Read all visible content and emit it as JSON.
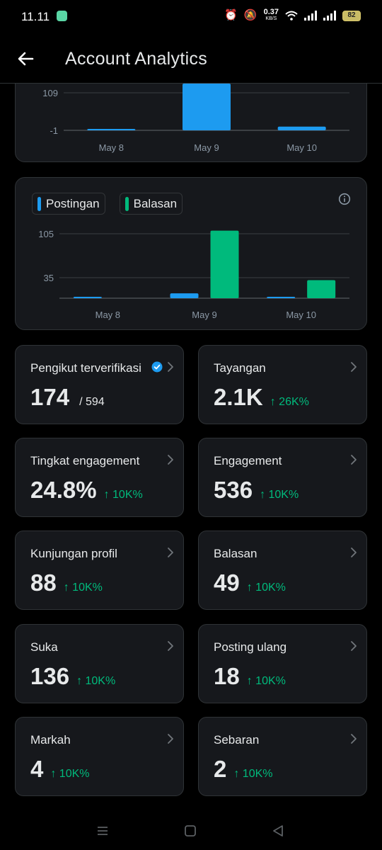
{
  "status_bar": {
    "time": "11.11",
    "network_speed": "0.37",
    "network_unit": "KB/S",
    "battery": "82",
    "icons": [
      "whatsapp-icon",
      "alarm-icon",
      "mute-icon",
      "wifi-icon",
      "signal-icon",
      "battery-icon"
    ]
  },
  "header": {
    "title": "Account Analytics",
    "back_icon": "arrow-left-icon"
  },
  "colors": {
    "blue": "#1d9bf0",
    "green": "#00ba7c",
    "positive_change": "#00ba7c",
    "card_bg": "#16181c",
    "card_border": "#2f3336"
  },
  "chart_data": [
    {
      "type": "bar",
      "categories": [
        "May 8",
        "May 9",
        "May 10"
      ],
      "y_ticks": [
        "109",
        "-1"
      ],
      "y_tick_values": [
        109,
        -1
      ],
      "series": [
        {
          "values": [
            1,
            136,
            10
          ],
          "color": "#1d9bf0"
        }
      ],
      "ylim": [
        -1,
        109
      ],
      "grid": true
    },
    {
      "type": "bar",
      "categories": [
        "May 8",
        "May 9",
        "May 10"
      ],
      "y_ticks": [
        "105",
        "35"
      ],
      "y_tick_values": [
        105,
        35
      ],
      "series": [
        {
          "name": "Postingan",
          "values": [
            2,
            10,
            2
          ],
          "color": "#1d9bf0"
        },
        {
          "name": "Balasan",
          "values": [
            0,
            110,
            31
          ],
          "color": "#00ba7c"
        }
      ],
      "ylim": [
        0,
        105
      ],
      "grid": true,
      "legend": "top-left"
    }
  ],
  "metrics": [
    {
      "label": "Pengikut terverifikasi",
      "value": "174",
      "sub": "/ 594",
      "change": "",
      "verified": true
    },
    {
      "label": "Tayangan",
      "value": "2.1K",
      "sub": "",
      "change": "↑ 26K%",
      "verified": false
    },
    {
      "label": "Tingkat engagement",
      "value": "24.8%",
      "sub": "",
      "change": "↑ 10K%",
      "verified": false
    },
    {
      "label": "Engagement",
      "value": "536",
      "sub": "",
      "change": "↑ 10K%",
      "verified": false
    },
    {
      "label": "Kunjungan profil",
      "value": "88",
      "sub": "",
      "change": "↑ 10K%",
      "verified": false
    },
    {
      "label": "Balasan",
      "value": "49",
      "sub": "",
      "change": "↑ 10K%",
      "verified": false
    },
    {
      "label": "Suka",
      "value": "136",
      "sub": "",
      "change": "↑ 10K%",
      "verified": false
    },
    {
      "label": "Posting ulang",
      "value": "18",
      "sub": "",
      "change": "↑ 10K%",
      "verified": false
    },
    {
      "label": "Markah",
      "value": "4",
      "sub": "",
      "change": "↑ 10K%",
      "verified": false
    },
    {
      "label": "Sebaran",
      "value": "2",
      "sub": "",
      "change": "↑ 10K%",
      "verified": false
    }
  ],
  "nav_bar": [
    "menu-icon",
    "home-square-icon",
    "back-triangle-icon"
  ]
}
